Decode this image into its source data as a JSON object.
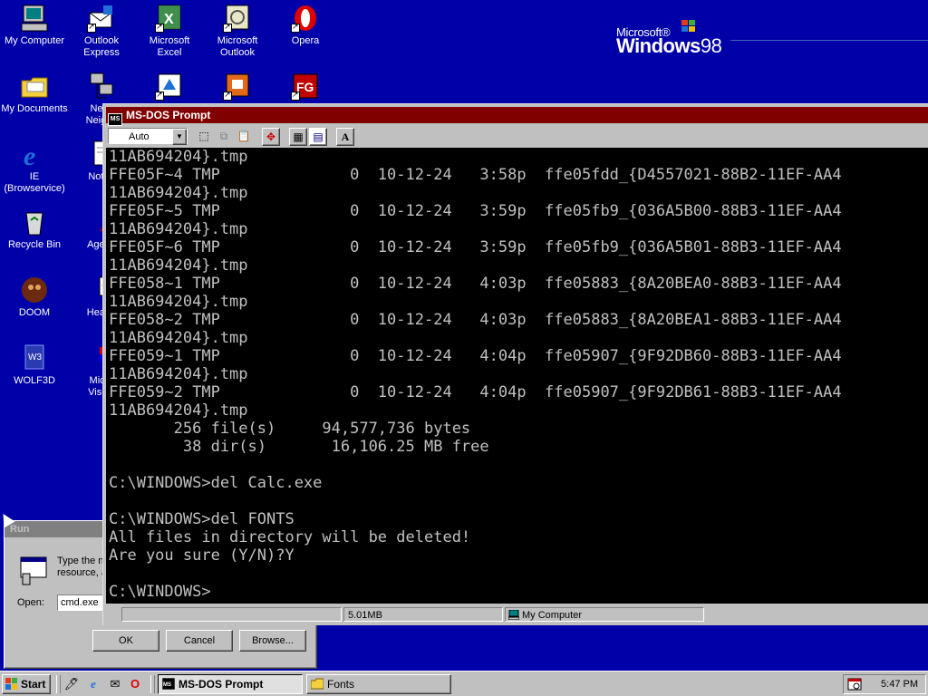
{
  "desktop": {
    "icons": [
      {
        "name": "my-computer",
        "label": "My Computer"
      },
      {
        "name": "outlook-express",
        "label": "Outlook\nExpress"
      },
      {
        "name": "microsoft-excel",
        "label": "Microsoft\nExcel"
      },
      {
        "name": "microsoft-outlook",
        "label": "Microsoft\nOutlook"
      },
      {
        "name": "opera",
        "label": "Opera"
      },
      {
        "name": "my-documents",
        "label": "My Documents"
      },
      {
        "name": "network-neighborhood",
        "label": "Netw\nNeighb"
      },
      {
        "name": "ie",
        "label": "IE\n(Browservice)"
      },
      {
        "name": "notepad",
        "label": "Notep"
      },
      {
        "name": "recycle-bin",
        "label": "Recycle Bin"
      },
      {
        "name": "age-of-empires",
        "label": "Age of"
      },
      {
        "name": "doom",
        "label": "DOOM"
      },
      {
        "name": "hearts",
        "label": "Hearts"
      },
      {
        "name": "wolf3d",
        "label": "WOLF3D"
      },
      {
        "name": "microsoft-visual",
        "label": "Micro\nVisual"
      }
    ],
    "logo": {
      "microsoft": "Microsoft®",
      "windows": "Windows",
      "version": "98"
    }
  },
  "run_dialog": {
    "title": "Run",
    "description_line1": "Type the n",
    "description_line2": "resource, a",
    "open_label": "Open:",
    "open_value": "cmd.exe",
    "ok": "OK",
    "cancel": "Cancel",
    "browse": "Browse..."
  },
  "dos_window": {
    "title": "MS-DOS Prompt",
    "font_size": "Auto",
    "console_lines": [
      "11AB694204}.tmp",
      "FFE05F~4 TMP              0  10-12-24   3:58p  ffe05fdd_{D4557021-88B2-11EF-AA4",
      "11AB694204}.tmp",
      "FFE05F~5 TMP              0  10-12-24   3:59p  ffe05fb9_{036A5B00-88B3-11EF-AA4",
      "11AB694204}.tmp",
      "FFE05F~6 TMP              0  10-12-24   3:59p  ffe05fb9_{036A5B01-88B3-11EF-AA4",
      "11AB694204}.tmp",
      "FFE058~1 TMP              0  10-12-24   4:03p  ffe05883_{8A20BEA0-88B3-11EF-AA4",
      "11AB694204}.tmp",
      "FFE058~2 TMP              0  10-12-24   4:03p  ffe05883_{8A20BEA1-88B3-11EF-AA4",
      "11AB694204}.tmp",
      "FFE059~1 TMP              0  10-12-24   4:04p  ffe05907_{9F92DB60-88B3-11EF-AA4",
      "11AB694204}.tmp",
      "FFE059~2 TMP              0  10-12-24   4:04p  ffe05907_{9F92DB61-88B3-11EF-AA4",
      "11AB694204}.tmp",
      "       256 file(s)     94,577,736 bytes",
      "        38 dir(s)       16,106.25 MB free",
      "",
      "C:\\WINDOWS>del Calc.exe",
      "",
      "C:\\WINDOWS>del FONTS",
      "All files in directory will be deleted!",
      "Are you sure (Y/N)?Y",
      "",
      "C:\\WINDOWS>"
    ],
    "status": {
      "size": "5.01MB",
      "location": "My Computer"
    }
  },
  "taskbar": {
    "start": "Start",
    "tasks": [
      {
        "name": "ms-dos-prompt",
        "label": "MS-DOS Prompt",
        "active": true
      },
      {
        "name": "fonts",
        "label": "Fonts",
        "active": false
      }
    ],
    "clock": "5:47 PM"
  },
  "colors": {
    "desktop": "#0000a8",
    "dos_title": "#800000",
    "face": "#c0c0c0"
  }
}
